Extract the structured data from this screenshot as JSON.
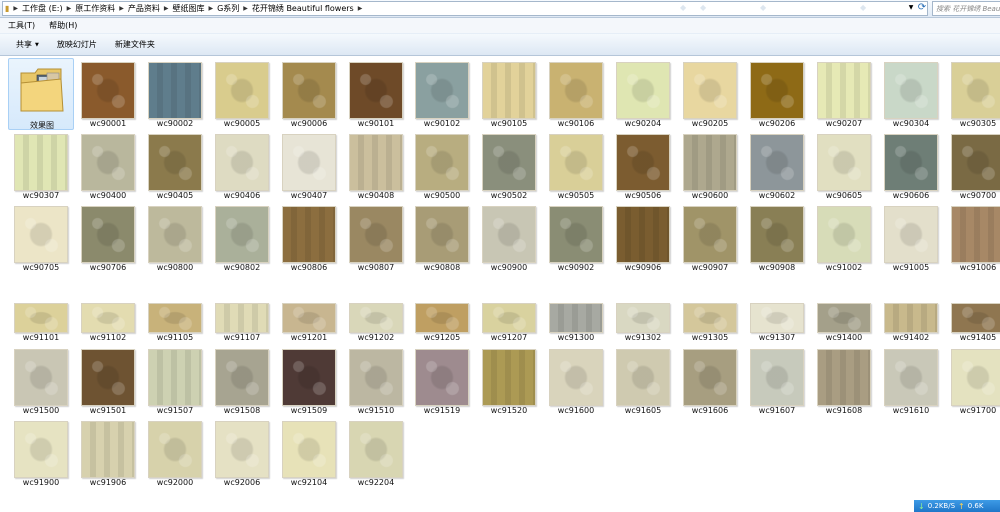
{
  "address": {
    "crumbs": [
      "工作盘 (E:)",
      "原工作资料",
      "产品资料",
      "壁纸图库",
      "G系列",
      "花开锦绣 Beautiful flowers"
    ],
    "search_placeholder": "搜索 花开锦绣 Beau"
  },
  "menu": [
    "工具(T)",
    "帮助(H)"
  ],
  "toolbar": {
    "share_label": "共享",
    "slideshow_label": "放映幻灯片",
    "new_folder_label": "新建文件夹"
  },
  "folder": {
    "label": "效果图"
  },
  "files": [
    [
      "wc90001",
      "wc90002",
      "wc90005",
      "wc90006",
      "wc90101",
      "wc90102",
      "wc90105",
      "wc90106",
      "wc90204",
      "wc90205",
      "wc90206",
      "wc90207",
      "wc90304",
      "wc90305"
    ],
    [
      "wc90307",
      "wc90400",
      "wc90405",
      "wc90406",
      "wc90407",
      "wc90408",
      "wc90500",
      "wc90502",
      "wc90505",
      "wc90506",
      "wc90600",
      "wc90602",
      "wc90605",
      "wc90606",
      "wc90700"
    ],
    [
      "wc90705",
      "wc90706",
      "wc90800",
      "wc90802",
      "wc90806",
      "wc90807",
      "wc90808",
      "wc90900",
      "wc90902",
      "wc90906",
      "wc90907",
      "wc90908",
      "wc91002",
      "wc91005",
      "wc91006"
    ],
    [
      "wc91101",
      "wc91102",
      "wc91105",
      "wc91107",
      "wc91201",
      "wc91202",
      "wc91205",
      "wc91207",
      "wc91300",
      "wc91302",
      "wc91305",
      "wc91307",
      "wc91400",
      "wc91402",
      "wc91405"
    ],
    [
      "wc91500",
      "wc91501",
      "wc91507",
      "wc91508",
      "wc91509",
      "wc91510",
      "wc91519",
      "wc91520",
      "wc91600",
      "wc91605",
      "wc91606",
      "wc91607",
      "wc91608",
      "wc91610",
      "wc91700"
    ],
    [
      "wc91900",
      "wc91906",
      "wc92000",
      "wc92006",
      "wc92104",
      "wc92204"
    ]
  ],
  "status": {
    "download_speed": "0.2KB/S",
    "upload_speed": "0.6K"
  }
}
